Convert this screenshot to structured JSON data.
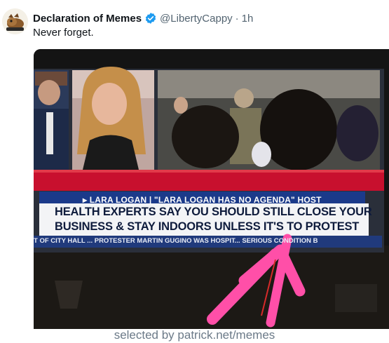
{
  "tweet": {
    "author_name": "Declaration of Memes",
    "handle": "@LibertyCappy",
    "separator": "·",
    "time": "1h",
    "text": "Never forget."
  },
  "media": {
    "banner_name": "▸ LARA LOGAN | \"LARA LOGAN HAS NO AGENDA\" HOST",
    "headline_line1": "HEALTH EXPERTS SAY YOU SHOULD STILL CLOSE YOUR",
    "headline_line2": "BUSINESS & STAY INDOORS UNLESS IT'S TO PROTEST",
    "ticker": "T OF CITY HALL ... PROTESTER MARTIN GUGINO WAS HOSPIT... SERIOUS CONDITION B"
  },
  "footer": {
    "credit": "selected by patrick.net/memes"
  },
  "colors": {
    "verified": "#1d9bf0",
    "banner_red": "#c8102e",
    "banner_blue": "#1b3a8a",
    "annotation_pink": "#ff4fa8"
  },
  "icons": [
    "avatar-image",
    "verified-badge-icon"
  ]
}
